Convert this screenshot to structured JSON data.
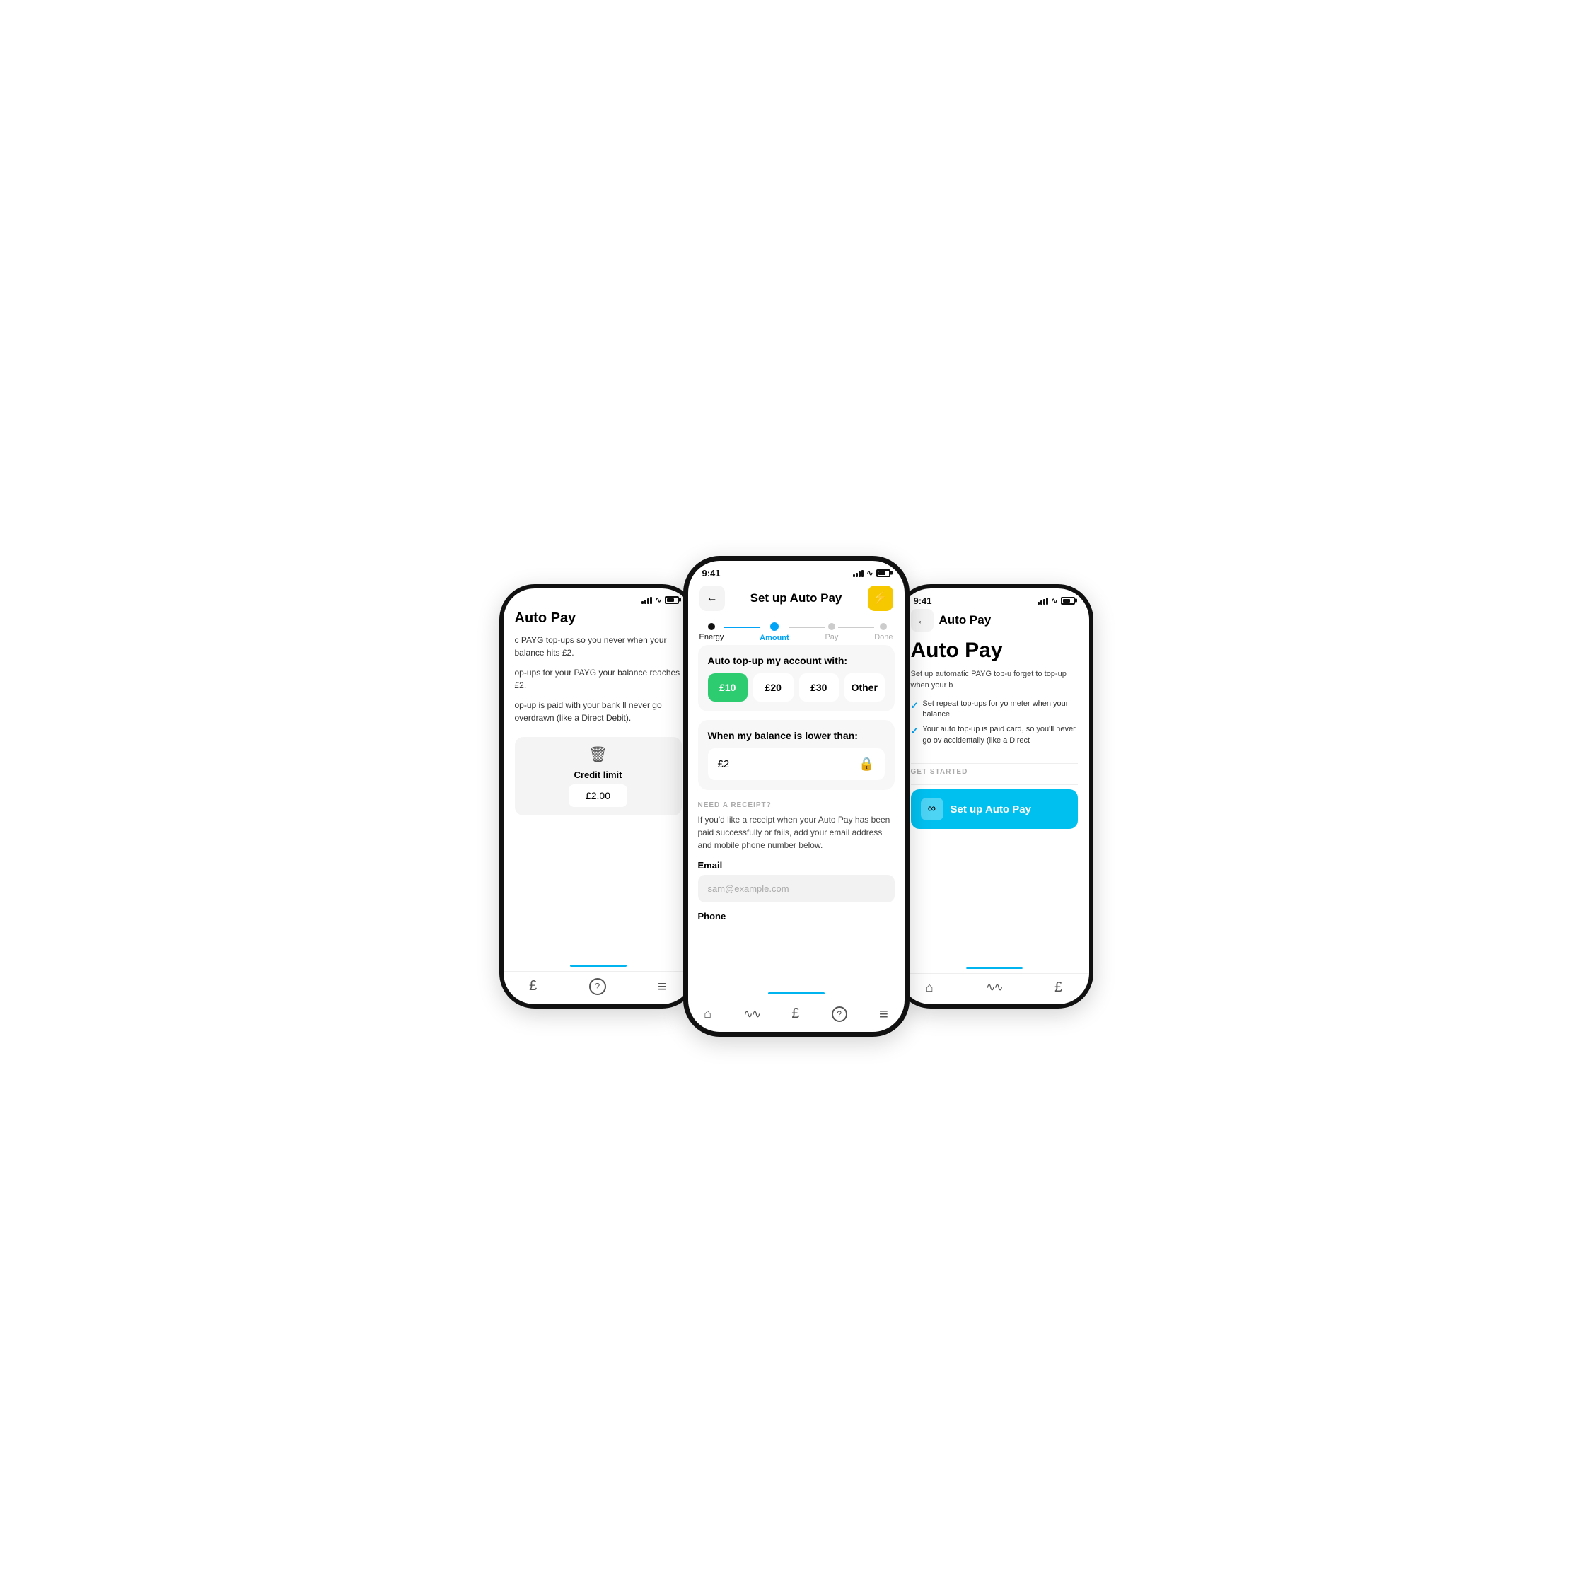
{
  "left_phone": {
    "title": "Auto Pay",
    "desc1": "c PAYG top-ups so you never\nwhen your balance hits £2.",
    "desc2": "op-ups for your PAYG\nyour balance reaches £2.",
    "desc3": "op-up is paid with your bank\nll never go overdrawn\n(like a Direct Debit).",
    "credit_label": "Credit limit",
    "credit_value": "£2.00",
    "nav": {
      "items": [
        "£",
        "?",
        "≡"
      ]
    }
  },
  "center_phone": {
    "status_time": "9:41",
    "header_title": "Set up Auto Pay",
    "steps": [
      {
        "label": "Energy",
        "state": "done"
      },
      {
        "label": "Amount",
        "state": "active"
      },
      {
        "label": "Pay",
        "state": ""
      },
      {
        "label": "Done",
        "state": ""
      }
    ],
    "top_up_title": "Auto top-up my account with:",
    "amounts": [
      {
        "value": "£10",
        "selected": true
      },
      {
        "value": "£20",
        "selected": false
      },
      {
        "value": "£30",
        "selected": false
      },
      {
        "value": "Other",
        "selected": false
      }
    ],
    "balance_title": "When my balance is lower than:",
    "balance_value": "£2",
    "receipt_label": "NEED A RECEIPT?",
    "receipt_desc": "If you'd like a receipt when your Auto Pay has been paid successfully or fails, add your email address and mobile phone number below.",
    "email_label": "Email",
    "email_placeholder": "sam@example.com",
    "phone_label": "Phone",
    "nav": {
      "items": [
        "⌂",
        "∿",
        "£",
        "?",
        "≡"
      ]
    }
  },
  "right_phone": {
    "status_time": "9:41",
    "back_label": "←",
    "header_title": "Auto Pay",
    "main_title": "Auto Pay",
    "desc": "Set up automatic PAYG top-u forget to top-up when your b",
    "checks": [
      "Set repeat top-ups for yo meter when your balance",
      "Your auto top-up is paid card, so you'll never go ov accidentally (like a Direct"
    ],
    "get_started_label": "GET STARTED",
    "setup_btn_label": "Set up Auto Pay",
    "nav": {
      "items": [
        "⌂",
        "∿",
        "£"
      ]
    }
  },
  "icons": {
    "back": "←",
    "lightning": "⚡",
    "lock": "🔒",
    "trash": "🗑",
    "infinity": "∞",
    "check": "✓"
  },
  "colors": {
    "green": "#2ecc71",
    "blue": "#00a3f5",
    "cyan": "#00c0f0",
    "yellow": "#f5c800",
    "light_bg": "#f7f7f7",
    "text_primary": "#111",
    "text_secondary": "#aaa"
  }
}
